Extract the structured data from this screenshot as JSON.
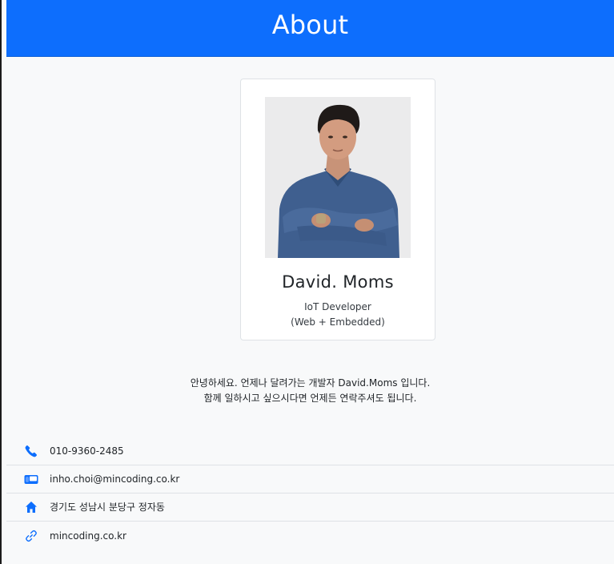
{
  "header": {
    "title": "About"
  },
  "profile": {
    "name": "David. Moms",
    "role_line1": "IoT Developer",
    "role_line2": "(Web + Embedded)"
  },
  "intro": {
    "line1": "안녕하세요. 언제나 달려가는 개발자 David.Moms 입니다.",
    "line2": "함께 일하시고 싶으시다면 언제든 연락주셔도 됩니다."
  },
  "contacts": [
    {
      "icon": "phone-icon",
      "text": "010-9360-2485"
    },
    {
      "icon": "mailbox-icon",
      "text": "inho.choi@mincoding.co.kr"
    },
    {
      "icon": "house-icon",
      "text": "경기도 성남시 분당구 정자동"
    },
    {
      "icon": "link-icon",
      "text": "mincoding.co.kr"
    }
  ],
  "colors": {
    "header_bg": "#0d6efd",
    "icon": "#0d6efd",
    "page_bg": "#f8f9fa"
  }
}
